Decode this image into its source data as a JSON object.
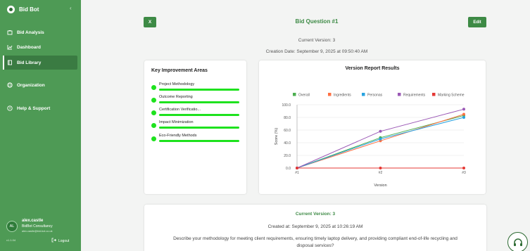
{
  "sidebar": {
    "brand": "Bid Bot",
    "items": [
      {
        "label": "Bid Analysis",
        "icon": "gavel-icon"
      },
      {
        "label": "Dashboard",
        "icon": "chart-icon"
      },
      {
        "label": "Bid Library",
        "icon": "book-icon"
      },
      {
        "label": "Organization",
        "icon": "globe-icon"
      },
      {
        "label": "Help & Support",
        "icon": "question-icon"
      }
    ],
    "active_item": "Bid Library",
    "user": {
      "initials": "AL",
      "name": "alex.castle",
      "org": "BidBot Consultancy",
      "email": "alex.castle@bid-bot.co.uk"
    },
    "version": "v1.1.04",
    "logout": "Logout"
  },
  "header": {
    "close_label": "X",
    "title": "Bid Question #1",
    "edit_label": "Edit",
    "current_version": "Current Version: 3",
    "creation_date": "Creation Date: September 9, 2025 at 09:50:40 AM"
  },
  "improvement": {
    "title": "Key Improvement Areas",
    "items": [
      {
        "label": "Project Methodology"
      },
      {
        "label": "Outcome Reporting"
      },
      {
        "label": "Certification Verificatio..."
      },
      {
        "label": "Impact Minimization"
      },
      {
        "label": "Eco-Friendly Methods"
      }
    ]
  },
  "chart_title": "Version Report Results",
  "chart_data": {
    "type": "line",
    "title": "Version Report Results",
    "xlabel": "Version",
    "ylabel": "Score (%)",
    "categories": [
      "#1",
      "#2",
      "#3"
    ],
    "ylim": [
      0,
      100
    ],
    "yticks": [
      "0.0",
      "20.0",
      "40.0",
      "60.0",
      "80.0",
      "100.0"
    ],
    "grid": true,
    "legend": "top",
    "series": [
      {
        "name": "Overall",
        "color": "#4caf50",
        "values": [
          0,
          48,
          83
        ]
      },
      {
        "name": "Ingredients",
        "color": "#ff7043",
        "values": [
          0,
          43,
          85
        ]
      },
      {
        "name": "Personas",
        "color": "#29a3e0",
        "values": [
          0,
          46,
          80
        ]
      },
      {
        "name": "Requirements",
        "color": "#9b59b6",
        "values": [
          0,
          58,
          93
        ]
      },
      {
        "name": "Marking Scheme",
        "color": "#e53935",
        "values": [
          0,
          0,
          0
        ]
      }
    ]
  },
  "detail": {
    "current_version": "Current Version: 3",
    "created_at": "Created at: September 9, 2025 at 10:26:19 AM",
    "question": "Describe your methodology for meeting client requirements, ensuring timely laptop delivery, and providing compliant end-of-life recycling and disposal services?"
  },
  "colors": {
    "primary": "#3d8a45",
    "sidebar": "#4e9a55",
    "progress": "#1ee21e"
  }
}
